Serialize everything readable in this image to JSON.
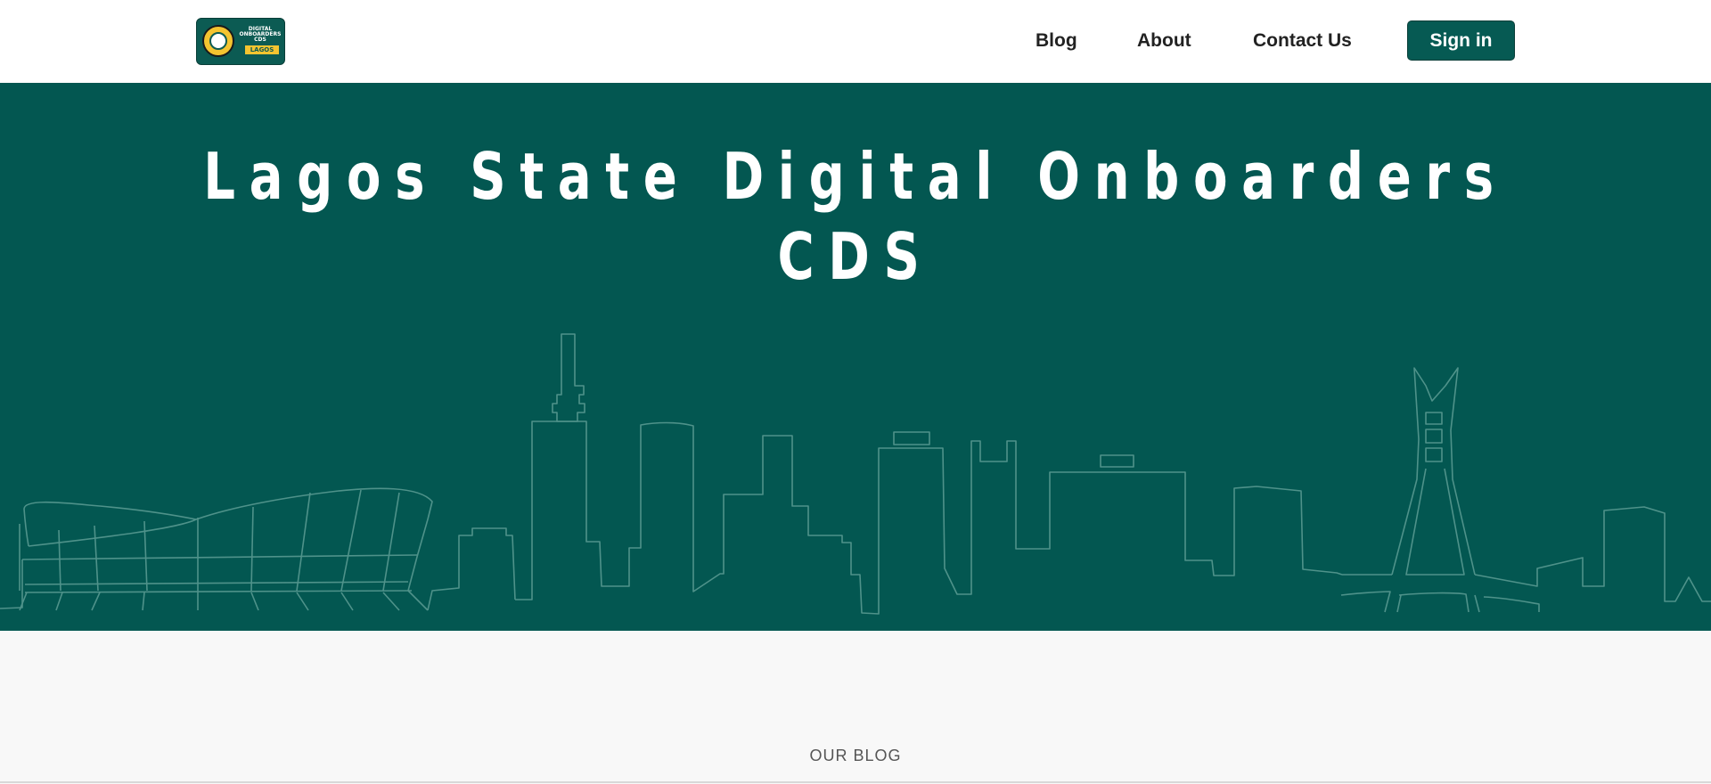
{
  "logo": {
    "lines": [
      "DIGITAL",
      "ONBOARDERS",
      "CDS"
    ],
    "tag": "LAGOS"
  },
  "nav": {
    "links": [
      "Blog",
      "About",
      "Contact Us"
    ],
    "signin_label": "Sign in"
  },
  "hero": {
    "title": "Lagos State Digital Onboarders CDS"
  },
  "blog": {
    "label": "OUR BLOG"
  },
  "colors": {
    "brand": "#035751",
    "button": "#065a53",
    "skyline_stroke": "#4f928a"
  }
}
